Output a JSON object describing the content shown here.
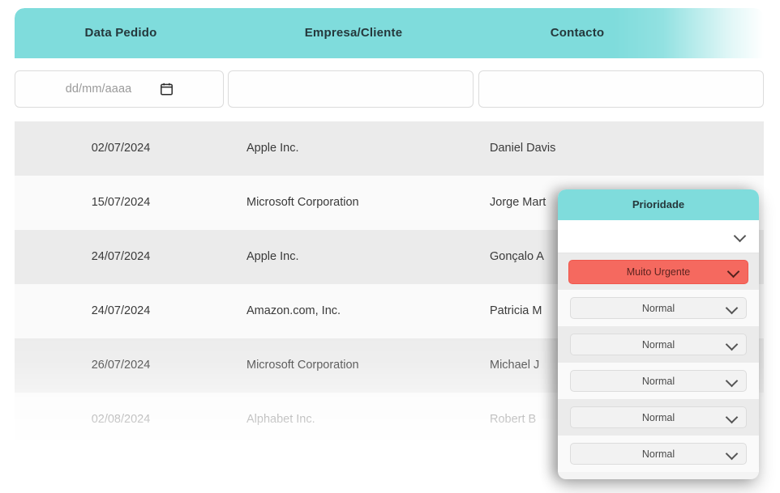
{
  "table": {
    "columns": [
      {
        "key": "data_pedido",
        "label": "Data Pedido"
      },
      {
        "key": "empresa_cliente",
        "label": "Empresa/Cliente"
      },
      {
        "key": "contacto",
        "label": "Contacto"
      }
    ],
    "filters": {
      "date_placeholder": "dd/mm/aaaa",
      "date_value": "",
      "empresa_value": "",
      "empresa_placeholder": "",
      "contacto_value": "",
      "contacto_placeholder": ""
    },
    "rows": [
      {
        "data_pedido": "02/07/2024",
        "empresa_cliente": "Apple Inc.",
        "contacto": "Daniel Davis"
      },
      {
        "data_pedido": "15/07/2024",
        "empresa_cliente": "Microsoft Corporation",
        "contacto": "Jorge Mart"
      },
      {
        "data_pedido": "24/07/2024",
        "empresa_cliente": "Apple Inc.",
        "contacto": "Gonçalo A"
      },
      {
        "data_pedido": "24/07/2024",
        "empresa_cliente": "Amazon.com, Inc.",
        "contacto": "Patricia M"
      },
      {
        "data_pedido": "26/07/2024",
        "empresa_cliente": "Microsoft Corporation",
        "contacto": "Michael J"
      },
      {
        "data_pedido": "02/08/2024",
        "empresa_cliente": "Alphabet Inc.",
        "contacto": "Robert B"
      }
    ]
  },
  "priority_panel": {
    "title": "Prioridade",
    "filter_value": "",
    "items": [
      {
        "value": "Muito Urgente",
        "level": "urgent"
      },
      {
        "value": "Normal",
        "level": "normal"
      },
      {
        "value": "Normal",
        "level": "normal"
      },
      {
        "value": "Normal",
        "level": "normal"
      },
      {
        "value": "Normal",
        "level": "normal"
      },
      {
        "value": "Normal",
        "level": "normal"
      }
    ]
  },
  "colors": {
    "header_teal": "#7fdcdc",
    "urgent_red": "#f5695f",
    "row_odd": "#ebebeb",
    "row_even": "#fafafa",
    "header_text": "#25383c"
  }
}
